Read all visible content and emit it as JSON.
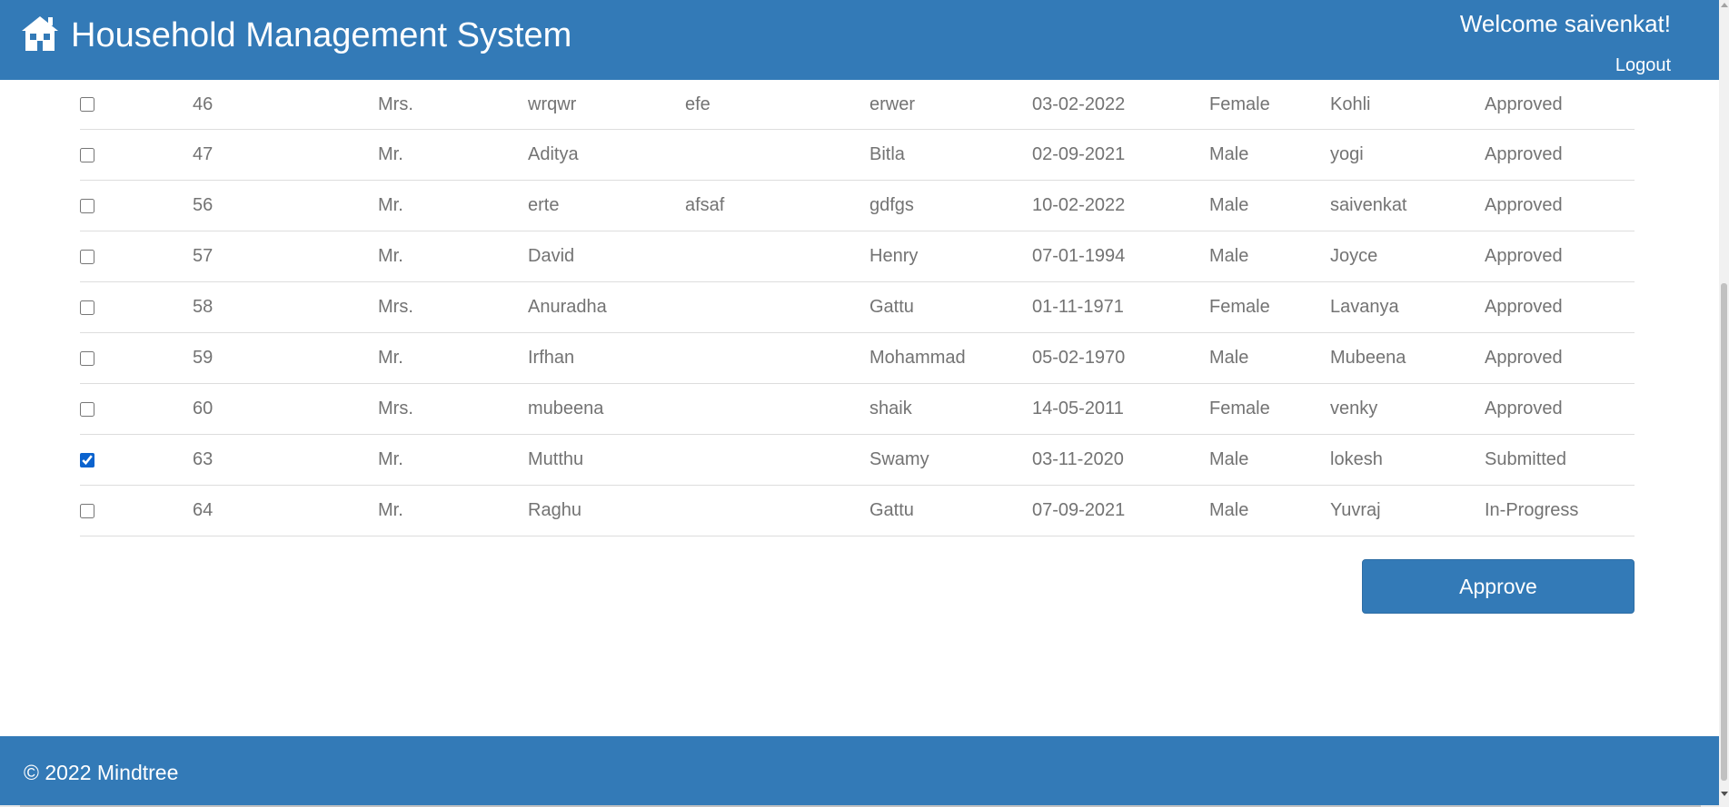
{
  "header": {
    "app_title": "Household Management System",
    "welcome_text": "Welcome saivenkat!",
    "logout_label": "Logout",
    "logo_icon": "house-icon"
  },
  "table": {
    "rows": [
      {
        "checked": false,
        "id": "46",
        "title": "Mrs.",
        "first_name": "wrqwr",
        "middle_name": "efe",
        "last_name": "erwer",
        "dob": "03-02-2022",
        "gender": "Female",
        "relation": "Kohli",
        "status": "Approved"
      },
      {
        "checked": false,
        "id": "47",
        "title": "Mr.",
        "first_name": "Aditya",
        "middle_name": "",
        "last_name": "Bitla",
        "dob": "02-09-2021",
        "gender": "Male",
        "relation": "yogi",
        "status": "Approved"
      },
      {
        "checked": false,
        "id": "56",
        "title": "Mr.",
        "first_name": "erte",
        "middle_name": "afsaf",
        "last_name": "gdfgs",
        "dob": "10-02-2022",
        "gender": "Male",
        "relation": "saivenkat",
        "status": "Approved"
      },
      {
        "checked": false,
        "id": "57",
        "title": "Mr.",
        "first_name": "David",
        "middle_name": "",
        "last_name": "Henry",
        "dob": "07-01-1994",
        "gender": "Male",
        "relation": "Joyce",
        "status": "Approved"
      },
      {
        "checked": false,
        "id": "58",
        "title": "Mrs.",
        "first_name": "Anuradha",
        "middle_name": "",
        "last_name": "Gattu",
        "dob": "01-11-1971",
        "gender": "Female",
        "relation": "Lavanya",
        "status": "Approved"
      },
      {
        "checked": false,
        "id": "59",
        "title": "Mr.",
        "first_name": "Irfhan",
        "middle_name": "",
        "last_name": "Mohammad",
        "dob": "05-02-1970",
        "gender": "Male",
        "relation": "Mubeena",
        "status": "Approved"
      },
      {
        "checked": false,
        "id": "60",
        "title": "Mrs.",
        "first_name": "mubeena",
        "middle_name": "",
        "last_name": "shaik",
        "dob": "14-05-2011",
        "gender": "Female",
        "relation": "venky",
        "status": "Approved"
      },
      {
        "checked": true,
        "id": "63",
        "title": "Mr.",
        "first_name": "Mutthu",
        "middle_name": "",
        "last_name": "Swamy",
        "dob": "03-11-2020",
        "gender": "Male",
        "relation": "lokesh",
        "status": "Submitted"
      },
      {
        "checked": false,
        "id": "64",
        "title": "Mr.",
        "first_name": "Raghu",
        "middle_name": "",
        "last_name": "Gattu",
        "dob": "07-09-2021",
        "gender": "Male",
        "relation": "Yuvraj",
        "status": "In-Progress"
      }
    ]
  },
  "actions": {
    "approve_label": "Approve"
  },
  "footer": {
    "copyright": "© 2022 Mindtree"
  },
  "colors": {
    "brand": "#337ab7",
    "text": "#737373",
    "row_border": "#dddddd"
  }
}
